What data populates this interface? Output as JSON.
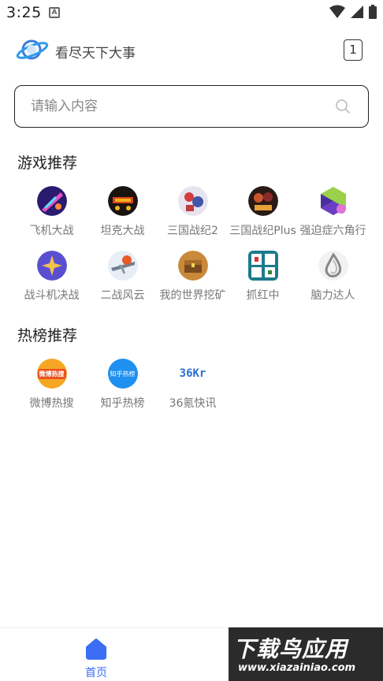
{
  "status": {
    "time": "3:25",
    "a_badge": "A"
  },
  "header": {
    "title": "看尽天下大事",
    "tab_count": "1"
  },
  "search": {
    "placeholder": "请输入内容"
  },
  "games": {
    "title": "游戏推荐",
    "items": [
      {
        "label": "飞机大战",
        "icon": "plane-game-icon"
      },
      {
        "label": "坦克大战",
        "icon": "tank-game-icon"
      },
      {
        "label": "三国战纪2",
        "icon": "three-kingdoms-2-icon"
      },
      {
        "label": "三国战纪Plus",
        "icon": "three-kingdoms-plus-icon"
      },
      {
        "label": "强迫症六角行",
        "icon": "hexagon-game-icon"
      },
      {
        "label": "战斗机决战",
        "icon": "fighter-jet-icon"
      },
      {
        "label": "二战风云",
        "icon": "ww2-plane-icon"
      },
      {
        "label": "我的世界挖矿",
        "icon": "treasure-chest-icon"
      },
      {
        "label": "抓红中",
        "icon": "mahjong-icon"
      },
      {
        "label": "脑力达人",
        "icon": "water-drop-icon"
      }
    ]
  },
  "hot": {
    "title": "热榜推荐",
    "items": [
      {
        "label": "微博热搜",
        "icon": "weibo-hot-icon",
        "badge": "微博热搜"
      },
      {
        "label": "知乎热榜",
        "icon": "zhihu-hot-icon",
        "badge": "知乎热榜"
      },
      {
        "label": "36氪快讯",
        "icon": "36kr-icon",
        "badge": "36Kr"
      }
    ]
  },
  "nav": {
    "home_label": "首页",
    "accent": "#3b6ef5"
  },
  "watermark": {
    "top": "下载鸟应用",
    "bottom": "www.xiazainiao.com"
  }
}
